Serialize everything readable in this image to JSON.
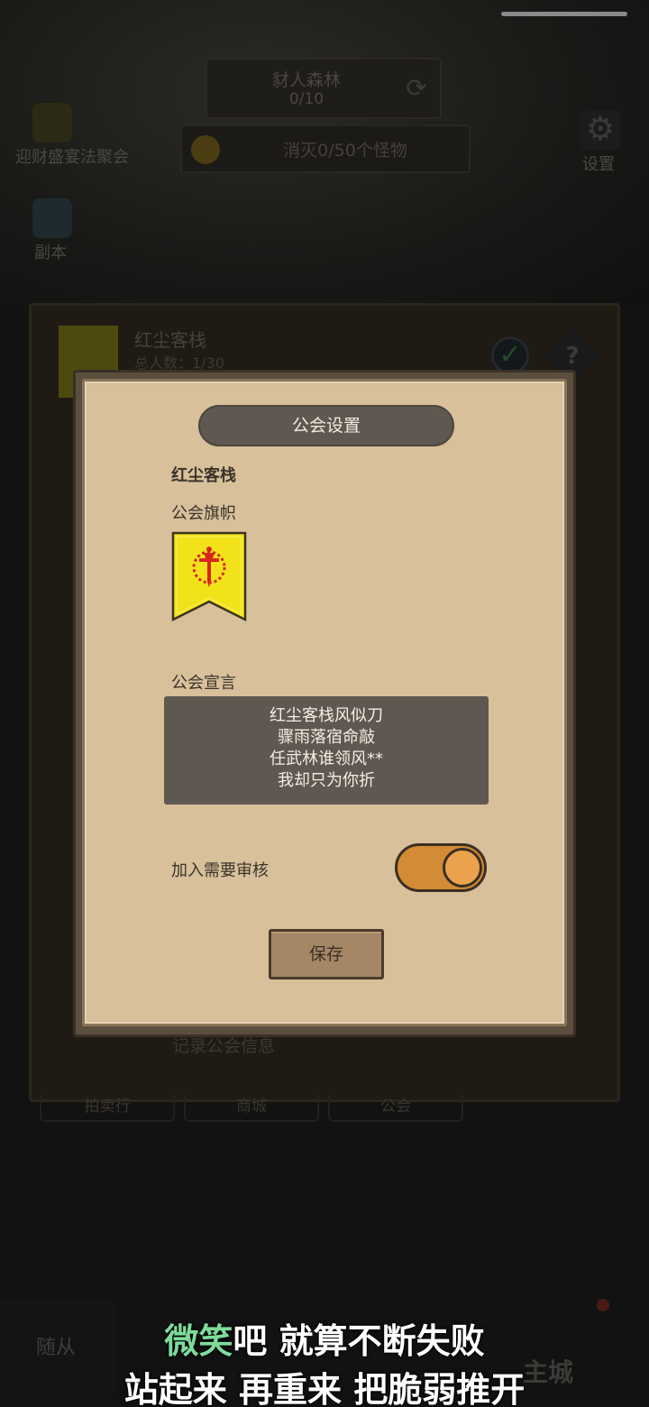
{
  "background": {
    "quest": {
      "title": "豺人森林",
      "progress": "0/10"
    },
    "task": {
      "text": "消灭0/50个怪物"
    },
    "event_label": "迎财盛宴法聚会",
    "settings_label": "设置",
    "dungeon_label": "副本",
    "guild_panel": {
      "name": "红尘客栈",
      "member_count": "总人数：1/30",
      "record_text": "记录公会信息",
      "tabs": [
        "拍卖行",
        "商城",
        "公会"
      ]
    },
    "bottom_nav": {
      "left_label": "随从",
      "main_city_label": "主城"
    }
  },
  "modal": {
    "title": "公会设置",
    "guild_name": "红尘客栈",
    "flag_label": "公会旗帜",
    "flag_colors": {
      "field": "#f2e21a",
      "emblem": "#d8261c",
      "outline": "#3a3420"
    },
    "manifesto_label": "公会宣言",
    "manifesto_lines": [
      "红尘客栈风似刀",
      "骤雨落宿命敲",
      "任武林谁领风**",
      "我却只为你折"
    ],
    "review_label": "加入需要审核",
    "review_required": true,
    "save_label": "保存"
  },
  "subtitle": {
    "line1_highlight": "微笑",
    "line1_rest": "吧  就算不断失败",
    "line2": "站起来  再重来  把脆弱推开"
  },
  "colors": {
    "parchment": "#d7c09a",
    "dark_panel": "#5e5850",
    "toggle_on": "#d38c35",
    "subtitle_highlight": "#7ddc9b"
  }
}
